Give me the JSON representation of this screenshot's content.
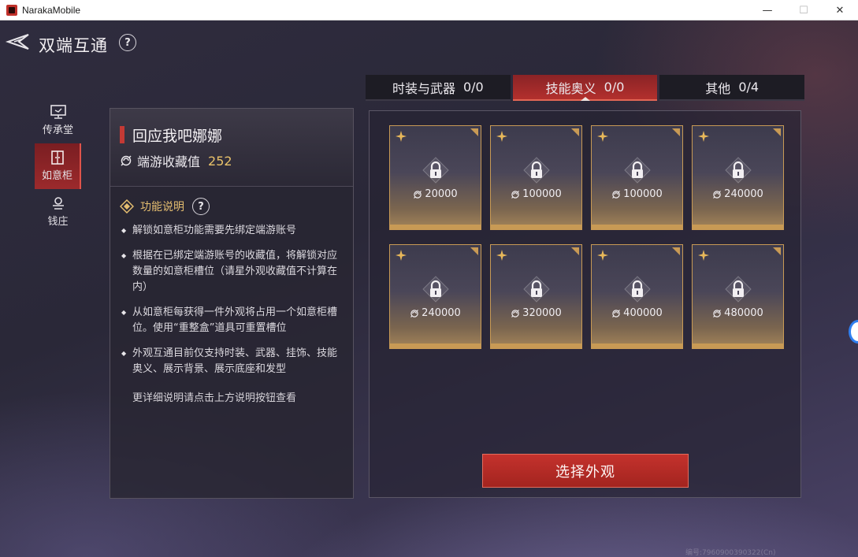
{
  "window": {
    "title": "NarakaMobile",
    "buttons": {
      "minimize": "—",
      "maximize": "☐",
      "close": "✕"
    }
  },
  "header": {
    "title": "双端互通",
    "help_symbol": "?"
  },
  "side_nav": {
    "items": [
      {
        "label": "传承堂",
        "icon": "monitor-icon",
        "active": false
      },
      {
        "label": "如意柜",
        "icon": "cabinet-icon",
        "active": true
      },
      {
        "label": "钱庄",
        "icon": "bank-icon",
        "active": false
      }
    ]
  },
  "info": {
    "player_name": "回应我吧娜娜",
    "score_label": "端游收藏值",
    "score_value": "252",
    "function_title": "功能说明",
    "function_help_symbol": "?",
    "rules": [
      "解锁如意柜功能需要先绑定端游账号",
      "根据在已绑定端游账号的收藏值，将解锁对应数量的如意柜槽位（请星外观收藏值不计算在内）",
      "从如意柜每获得一件外观将占用一个如意柜槽位。使用“重整盒”道具可重置槽位",
      "外观互通目前仅支持时装、武器、挂饰、技能奥义、展示背景、展示底座和发型"
    ],
    "more_note": "更详细说明请点击上方说明按钮查看"
  },
  "tabs": [
    {
      "label": "时装与武器",
      "count": "0/0",
      "active": false
    },
    {
      "label": "技能奥义",
      "count": "0/0",
      "active": true
    },
    {
      "label": "其他",
      "count": "0/4",
      "active": false
    }
  ],
  "slots": [
    {
      "cost": "20000",
      "locked": true
    },
    {
      "cost": "100000",
      "locked": true
    },
    {
      "cost": "100000",
      "locked": true
    },
    {
      "cost": "240000",
      "locked": true
    },
    {
      "cost": "240000",
      "locked": true
    },
    {
      "cost": "320000",
      "locked": true
    },
    {
      "cost": "400000",
      "locked": true
    },
    {
      "cost": "480000",
      "locked": true
    }
  ],
  "select_button": "选择外观",
  "watermark": "编号:7960900390322(Cn)",
  "colors": {
    "accent_red": "#b3302d",
    "gold": "#c89a55",
    "score_gold": "#e9c26a"
  }
}
